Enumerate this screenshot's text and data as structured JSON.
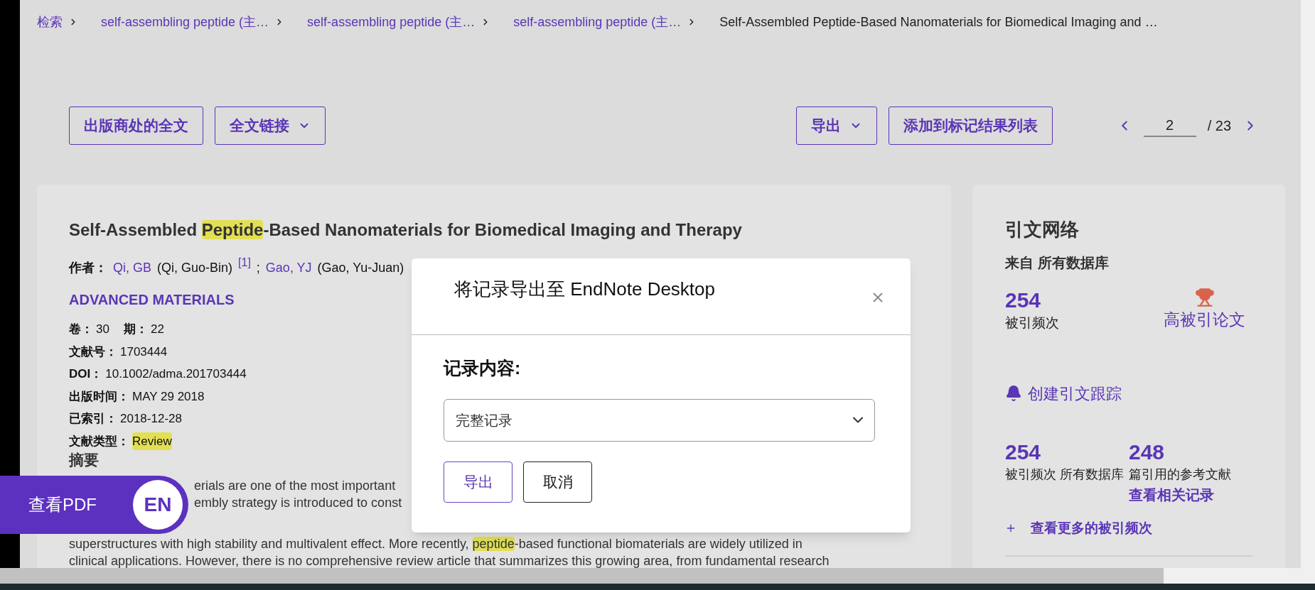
{
  "breadcrumb": [
    {
      "text": "检索",
      "current": false
    },
    {
      "text": "self-assembling peptide (主…",
      "current": false
    },
    {
      "text": "self-assembling peptide (主…",
      "current": false
    },
    {
      "text": "self-assembling peptide (主…",
      "current": false
    },
    {
      "text": "Self-Assembled Peptide-Based Nanomaterials for Biomedical Imaging and …",
      "current": true
    }
  ],
  "toolbar": {
    "left_buttons": [
      {
        "label": "出版商处的全文",
        "dropdown": false
      },
      {
        "label": "全文链接",
        "dropdown": true
      }
    ],
    "right_buttons": [
      {
        "label": "导出",
        "dropdown": true
      },
      {
        "label": "添加到标记结果列表",
        "dropdown": false
      }
    ],
    "pager": {
      "current": "2",
      "total": "/ 23"
    }
  },
  "record": {
    "title": [
      {
        "text": "Self-Assembled ",
        "highlighted": false
      },
      {
        "text": "Peptide",
        "highlighted": true
      },
      {
        "text": "-Based Nanomaterials for Biomedical Imaging and Therapy",
        "highlighted": false
      }
    ],
    "authors_label": "作者：",
    "authors": [
      {
        "short": "Qi, GB",
        "full": "(Qi, Guo-Bin)",
        "mark": "[1]"
      },
      {
        "short": "Gao, YJ",
        "full": "(Gao, Yu-Juan)"
      }
    ],
    "separator": ";",
    "journal": "ADVANCED MATERIALS",
    "fields": [
      [
        {
          "label": "卷：",
          "value": "30",
          "highlighted": false
        },
        {
          "label": "期：",
          "value": "22",
          "highlighted": false
        }
      ],
      [
        {
          "label": "文献号：",
          "value": "1703444",
          "highlighted": false
        }
      ],
      [
        {
          "label": "DOI：",
          "value": "10.1002/adma.201703444",
          "highlighted": false
        }
      ],
      [
        {
          "label": "出版时间：",
          "value": "MAY 29 2018",
          "highlighted": false
        }
      ],
      [
        {
          "label": "已索引：",
          "value": "2018-12-28",
          "highlighted": false
        }
      ],
      [
        {
          "label": "文献类型：",
          "value": "Review",
          "highlighted": true
        }
      ]
    ],
    "abstract": {
      "heading": "摘要",
      "lines": [
        {
          "parts": [
            {
              "text": "erials are one of the most important",
              "highlighted": false
            }
          ]
        },
        {
          "parts": [
            {
              "text": "embly strategy is introduced to const",
              "highlighted": false
            }
          ]
        },
        {
          "parts": [
            {
              "text": "superstructures with high stability and multivalent effect. More recently, ",
              "highlighted": false
            },
            {
              "text": "peptide",
              "highlighted": true
            },
            {
              "text": "-based functional biomaterials are widely utilized in",
              "highlighted": false
            }
          ]
        },
        {
          "parts": [
            {
              "text": "clinical applications. However, there is no comprehensive review article that summarizes this growing area, from fundamental research",
              "highlighted": false
            }
          ]
        }
      ]
    }
  },
  "pdf_button": {
    "label": "查看PDF",
    "badge": "EN"
  },
  "citation": {
    "title": "引文网络",
    "source": "来自 所有数据库",
    "times_cited": {
      "count": "254",
      "label": "被引频次"
    },
    "highly_cited": "高被引论文",
    "alert": "创建引文跟踪",
    "stats": [
      {
        "count": "254",
        "label": "被引频次 所有数据库"
      },
      {
        "count": "248",
        "label": "篇引用的参考文献",
        "link": "查看相关记录"
      }
    ],
    "more": "查看更多的被引频次"
  },
  "modal": {
    "title": "将记录导出至 EndNote Desktop",
    "field_label": "记录内容:",
    "select_value": "完整记录",
    "buttons": [
      {
        "label": "导出",
        "kind": "primary"
      },
      {
        "label": "取消",
        "kind": "secondary"
      }
    ]
  }
}
